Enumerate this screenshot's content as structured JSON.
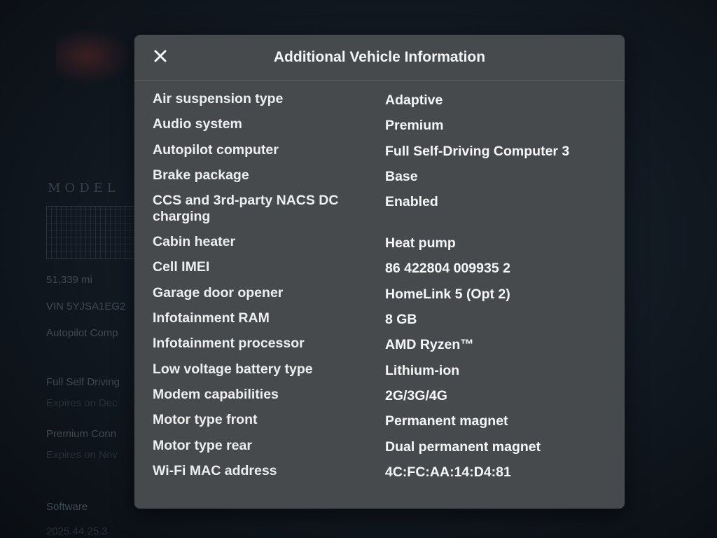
{
  "background": {
    "model_name": "MODEL",
    "odometer": "51,339 mi",
    "vin": "VIN 5YJSA1EG2",
    "autopilot": "Autopilot Comp",
    "fsd": "Full Self Driving",
    "fsd_expiry": "Expires on Dec",
    "connectivity": "Premium Conn",
    "connectivity_expiry": "Expires on Nov",
    "software_label": "Software",
    "software_version": "2025.44.25.3"
  },
  "modal": {
    "title": "Additional Vehicle Information",
    "close_icon": "close-icon",
    "rows": [
      {
        "label": "Air suspension type",
        "value": "Adaptive"
      },
      {
        "label": "Audio system",
        "value": "Premium"
      },
      {
        "label": "Autopilot computer",
        "value": "Full Self-Driving Computer 3"
      },
      {
        "label": "Brake package",
        "value": "Base"
      },
      {
        "label": "CCS and 3rd-party NACS DC charging",
        "value": "Enabled"
      },
      {
        "label": "Cabin heater",
        "value": "Heat pump"
      },
      {
        "label": "Cell IMEI",
        "value": "86 422804 009935 2"
      },
      {
        "label": "Garage door opener",
        "value": "HomeLink 5 (Opt 2)"
      },
      {
        "label": "Infotainment RAM",
        "value": "8 GB"
      },
      {
        "label": "Infotainment processor",
        "value": "AMD Ryzen™"
      },
      {
        "label": "Low voltage battery type",
        "value": "Lithium-ion"
      },
      {
        "label": "Modem capabilities",
        "value": "2G/3G/4G"
      },
      {
        "label": "Motor type front",
        "value": "Permanent magnet"
      },
      {
        "label": "Motor type rear",
        "value": "Dual permanent magnet"
      },
      {
        "label": "Wi-Fi MAC address",
        "value": "4C:FC:AA:14:D4:81"
      }
    ]
  },
  "colors": {
    "modal_bg": "#474a4d",
    "screen_bg": "#111820",
    "text": "#f2f2f2"
  }
}
